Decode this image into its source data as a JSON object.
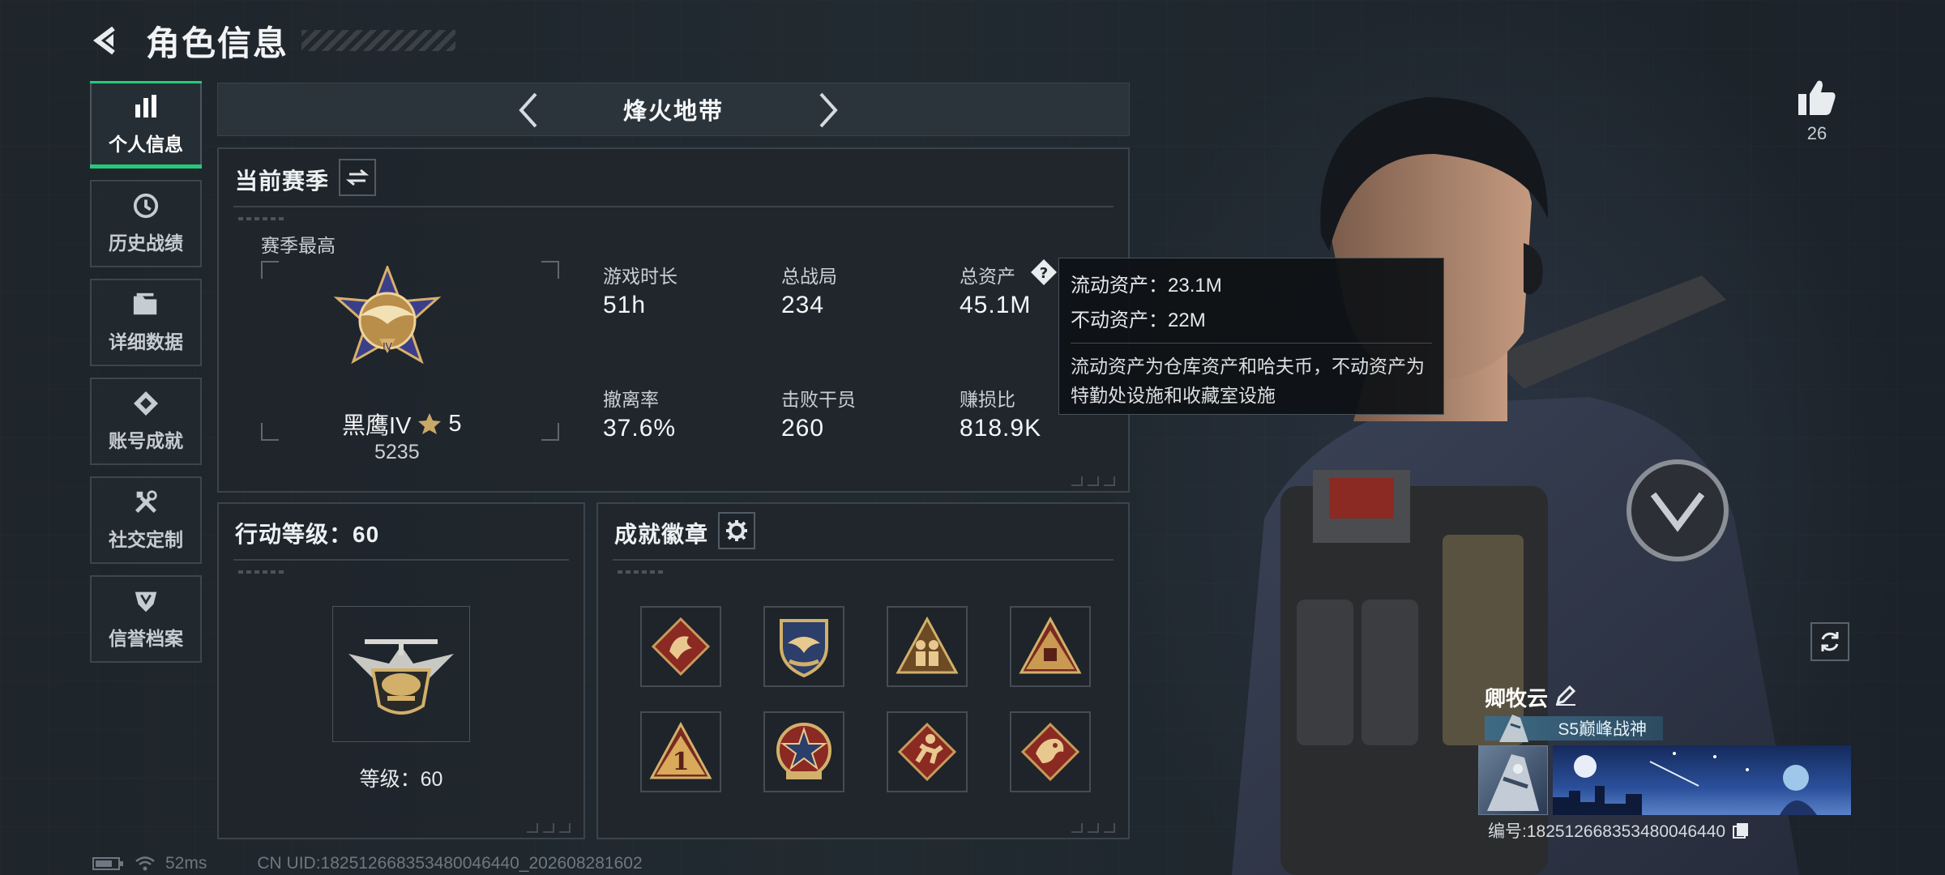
{
  "header": {
    "title": "角色信息"
  },
  "sidebar": {
    "items": [
      {
        "label": "个人信息",
        "icon": "bar-chart-icon",
        "active": true
      },
      {
        "label": "历史战绩",
        "icon": "history-icon",
        "active": false
      },
      {
        "label": "详细数据",
        "icon": "folder-icon",
        "active": false
      },
      {
        "label": "账号成就",
        "icon": "achievement-icon",
        "active": false
      },
      {
        "label": "社交定制",
        "icon": "tools-icon",
        "active": false
      },
      {
        "label": "信誉档案",
        "icon": "shield-icon",
        "active": false
      }
    ]
  },
  "mode": {
    "title": "烽火地带"
  },
  "season": {
    "title": "当前赛季",
    "best_label": "赛季最高",
    "rank_name": "黑鹰IV",
    "rank_stars": "5",
    "rank_points": "5235",
    "stats": [
      {
        "label": "游戏时长",
        "value": "51h"
      },
      {
        "label": "总战局",
        "value": "234"
      },
      {
        "label": "总资产",
        "value": "45.1M"
      },
      {
        "label": "撤离率",
        "value": "37.6%"
      },
      {
        "label": "击败干员",
        "value": "260"
      },
      {
        "label": "赚损比",
        "value": "818.9K"
      }
    ]
  },
  "tooltip": {
    "liquid": "流动资产：23.1M",
    "fixed": "不动资产：22M",
    "desc": "流动资产为仓库资产和哈夫币，不动资产为特勤处设施和收藏室设施"
  },
  "action_level": {
    "title": "行动等级：60",
    "level_text": "等级：60"
  },
  "badges": {
    "title": "成就徽章",
    "icons": [
      "dragon-badge-icon",
      "eagle-shield-badge-icon",
      "soldiers-badge-icon",
      "supply-badge-icon",
      "number-one-badge-icon",
      "star-emblem-badge-icon",
      "runner-badge-icon",
      "dragon-head-badge-icon"
    ]
  },
  "profile": {
    "likes": "26",
    "player_name": "卿牧云",
    "player_title": "S5巅峰战神",
    "player_id": "编号:1825126683534800464​40"
  },
  "status": {
    "ping": "52ms",
    "uid": "CN UID:182512668353480046440_202608281602"
  },
  "colors": {
    "accent": "#26c97b",
    "panel_border": "#3b444c",
    "background": "#1c2228"
  }
}
